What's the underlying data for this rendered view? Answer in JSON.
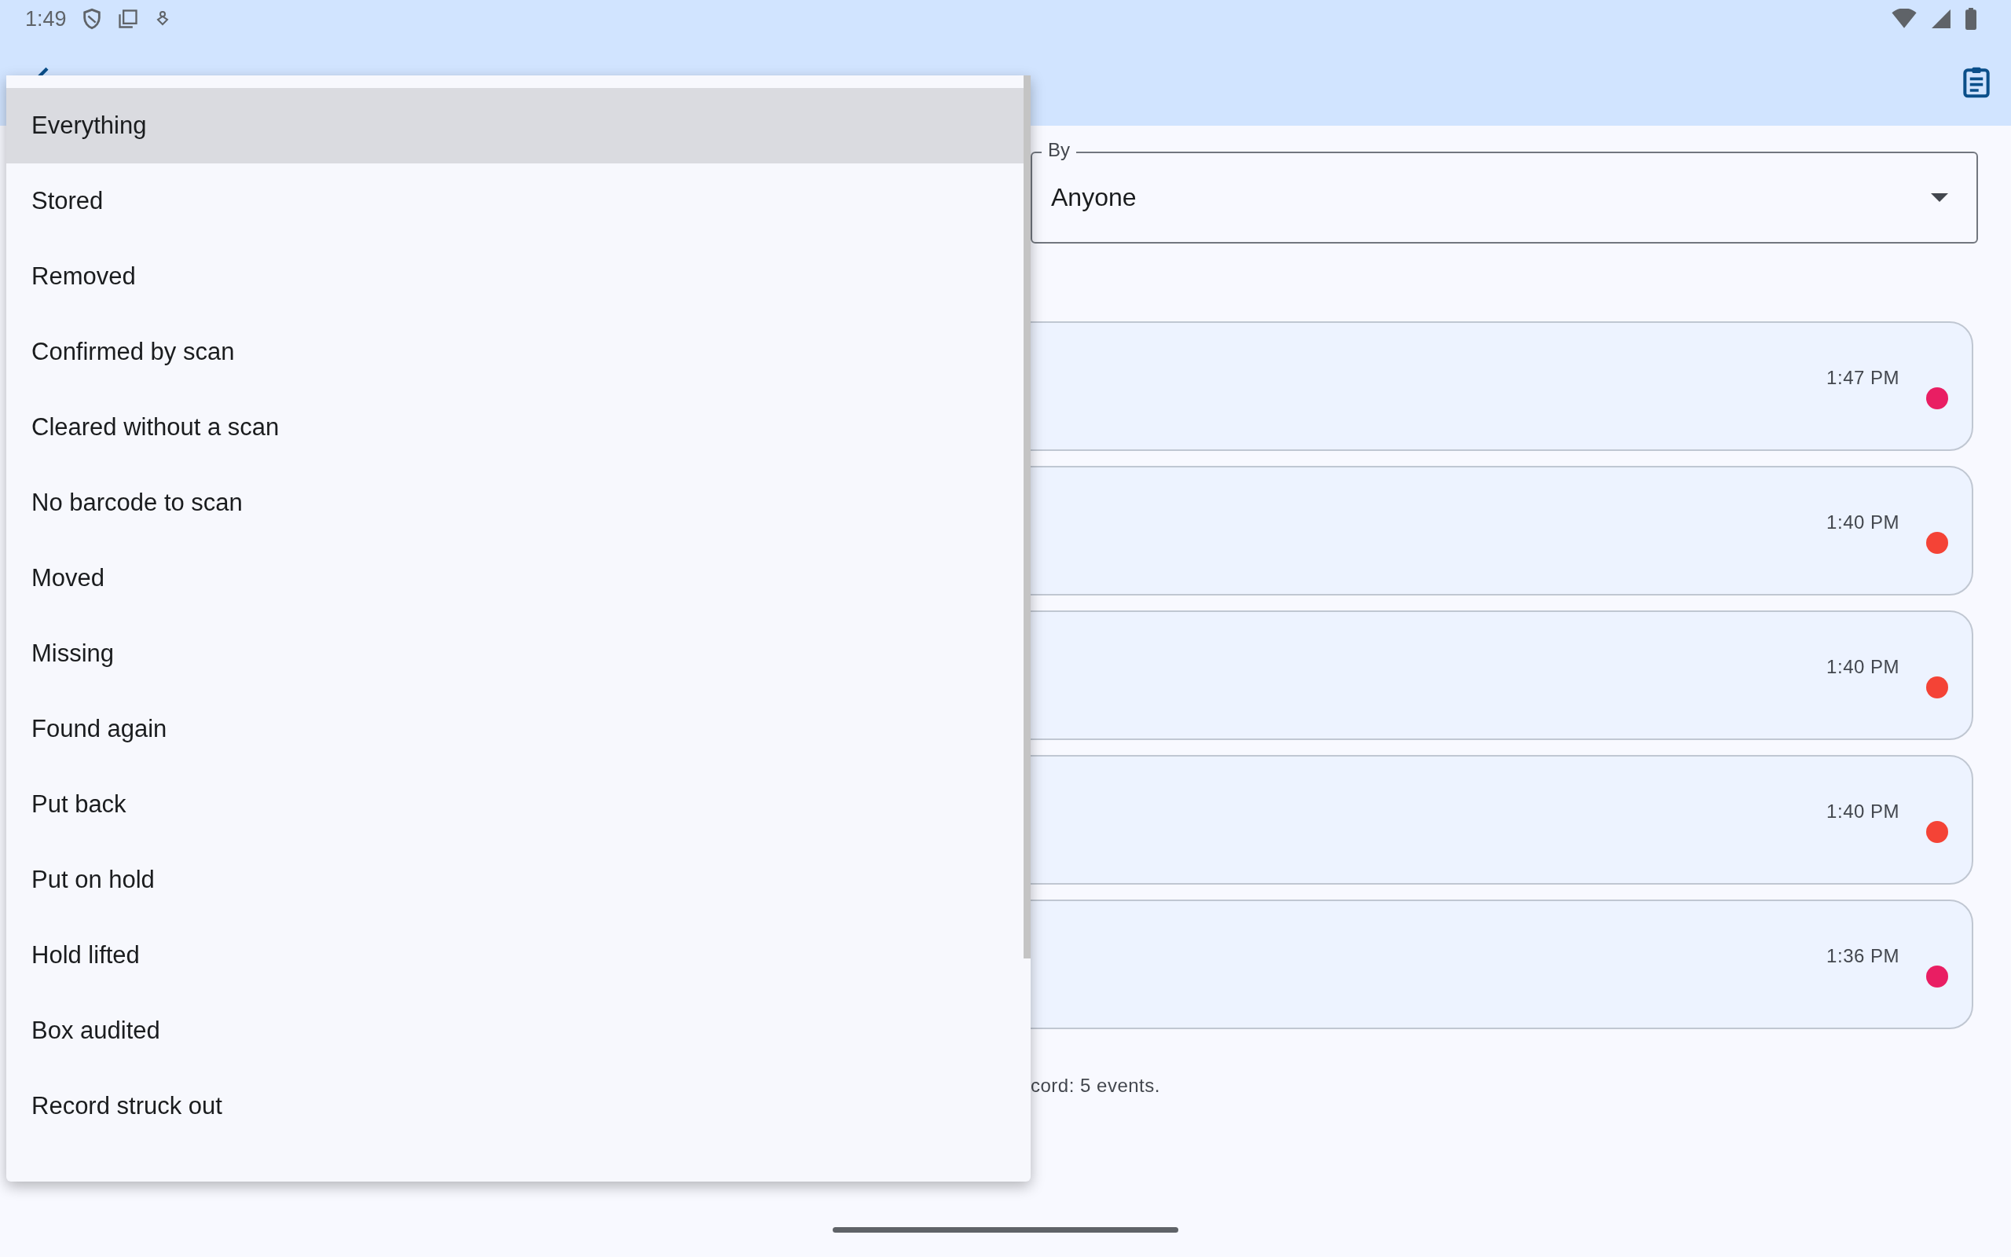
{
  "status_bar": {
    "time": "1:49"
  },
  "filter": {
    "label": "By",
    "value": "Anyone"
  },
  "events": [
    {
      "time": "1:47 PM",
      "color": "#e91e63"
    },
    {
      "time": "1:40 PM",
      "color": "#f44336"
    },
    {
      "time": "1:40 PM",
      "color": "#f44336"
    },
    {
      "time": "1:40 PM",
      "color": "#f44336"
    },
    {
      "time": "1:36 PM",
      "color": "#e91e63"
    }
  ],
  "summary": "cord: 5 events.",
  "menu": {
    "items": [
      {
        "label": "Everything",
        "selected": true
      },
      {
        "label": "Stored",
        "selected": false
      },
      {
        "label": "Removed",
        "selected": false
      },
      {
        "label": "Confirmed by scan",
        "selected": false
      },
      {
        "label": "Cleared without a scan",
        "selected": false
      },
      {
        "label": "No barcode to scan",
        "selected": false
      },
      {
        "label": "Moved",
        "selected": false
      },
      {
        "label": "Missing",
        "selected": false
      },
      {
        "label": "Found again",
        "selected": false
      },
      {
        "label": "Put back",
        "selected": false
      },
      {
        "label": "Put on hold",
        "selected": false
      },
      {
        "label": "Hold lifted",
        "selected": false
      },
      {
        "label": "Box audited",
        "selected": false
      },
      {
        "label": "Record struck out",
        "selected": false
      }
    ]
  }
}
